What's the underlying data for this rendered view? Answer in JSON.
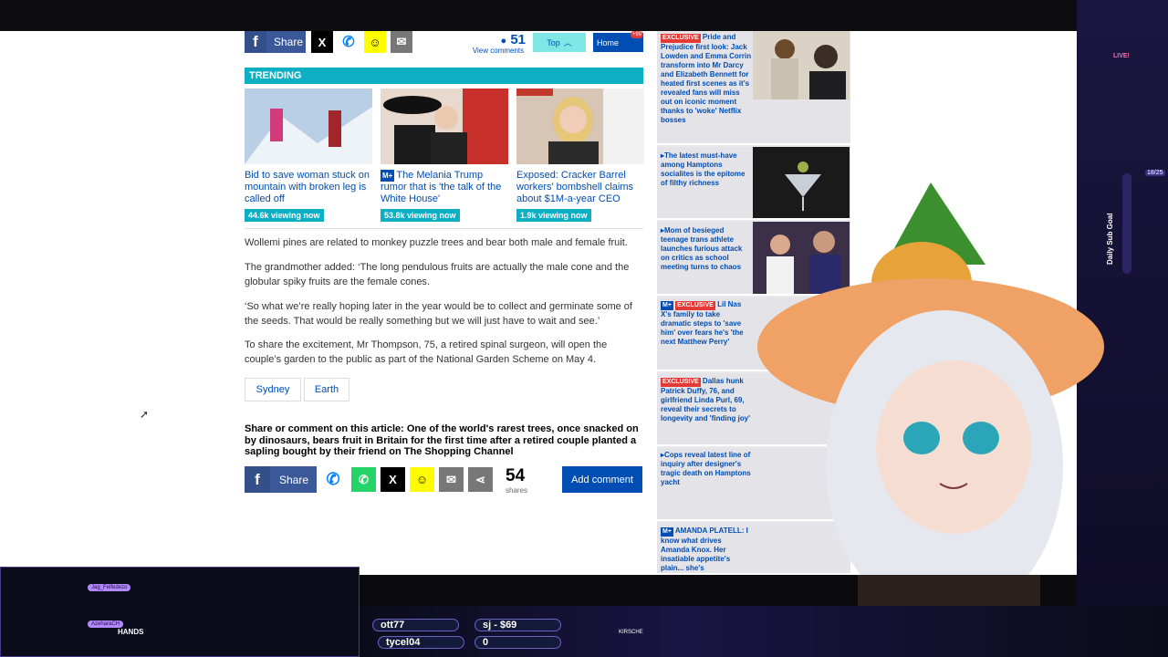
{
  "share_bar": {
    "share_label": "Share",
    "comments_count": "51",
    "view_comments": "View comments",
    "top_label": "Top",
    "home_label": "Home",
    "home_badge": "+99"
  },
  "trending": {
    "header": "TRENDING",
    "items": [
      {
        "title": "Bid to save woman stuck on mountain with broken leg is called off",
        "badge": "",
        "viewing": "44.6k viewing now"
      },
      {
        "title": "The Melania Trump rumor that is 'the talk of the White House'",
        "badge": "M+",
        "viewing": "53.8k viewing now"
      },
      {
        "title": "Exposed: Cracker Barrel workers' bombshell claims about $1M-a-year CEO",
        "badge": "",
        "viewing": "1.9k viewing now"
      }
    ]
  },
  "article": {
    "paragraphs": [
      "Wollemi pines are related to monkey puzzle trees and bear both male and female fruit.",
      "The grandmother added: ‘The long pendulous fruits are actually the male cone and the globular spiky fruits are the female cones.",
      "‘So what we’re really hoping later in the year would be to collect and germinate some of the seeds. That would be really something but we will just have to wait and see.’",
      "To share the excitement, Mr Thompson, 75, a retired spinal surgeon, will open the couple’s garden to the public as part of the National Garden Scheme on May 4."
    ],
    "tags": [
      "Sydney",
      "Earth"
    ],
    "share_heading": "Share or comment on this article: One of the world's rarest trees, once snacked on by dinosaurs, bears fruit in Britain for the first time after a retired couple planted a sapling bought by their friend on The Shopping Channel",
    "share_label": "Share",
    "shares_count": "54",
    "shares_label": "shares",
    "add_comment": "Add comment"
  },
  "sidebar": {
    "items": [
      {
        "exclusive": "EXCLUSIVE",
        "badge": "",
        "text": "Pride and Prejudice first look: Jack Lowden and Emma Corrin transform into Mr Darcy and Elizabeth Bennett for heated first scenes as it's revealed fans will miss out on iconic moment thanks to 'woke' Netflix bosses"
      },
      {
        "exclusive": "",
        "badge": "",
        "text": "The latest must-have among Hamptons socialites is the epitome of filthy richness"
      },
      {
        "exclusive": "",
        "badge": "",
        "text": "Mom of besieged teenage trans athlete launches furious attack on critics as school meeting turns to chaos"
      },
      {
        "exclusive": "EXCLUSIVE",
        "badge": "M+",
        "text": "Lil Nas X's family to take dramatic steps to 'save him' over fears he's 'the next Matthew Perry'"
      },
      {
        "exclusive": "EXCLUSIVE",
        "badge": "",
        "text": "Dallas hunk Patrick Duffy, 76, and girlfriend Linda Purl, 69, reveal their secrets to longevity and 'finding joy'"
      },
      {
        "exclusive": "",
        "badge": "",
        "text": "Cops reveal latest line of inquiry after designer's tragic death on Hamptons yacht"
      },
      {
        "exclusive": "",
        "badge": "M+",
        "text": "AMANDA PLATELL: I know what drives Amanda Knox. Her insatiable appetite's plain... she's"
      }
    ]
  },
  "stream": {
    "live_label": "LIVE!",
    "goal_label": "Daily Sub Goal",
    "goal_count": "18/25",
    "chat": [
      {
        "name": "Jag_Felfedezo",
        "message": ""
      },
      {
        "name": "AzeharaCH",
        "message": "HANDS"
      }
    ],
    "ticker": [
      "ott77",
      "sj - $69",
      "tycel04",
      "0",
      "KIRSCHE"
    ]
  },
  "colors": {
    "brand_blue": "#004db3",
    "trending_teal": "#0dafc4",
    "exclusive_red": "#e53935",
    "facebook": "#3b5998"
  }
}
